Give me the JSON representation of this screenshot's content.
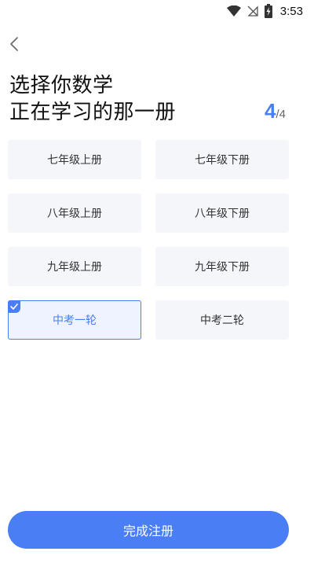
{
  "status_bar": {
    "time": "3:53",
    "icons": [
      "wifi-icon",
      "no-signal-icon",
      "battery-charging-icon"
    ]
  },
  "header": {
    "back_icon": "chevron-left-icon",
    "title_line1": "选择你数学",
    "title_line2": "正在学习的那一册",
    "step_current": "4",
    "step_total": "/4"
  },
  "options": [
    {
      "label": "七年级上册",
      "selected": false
    },
    {
      "label": "七年级下册",
      "selected": false
    },
    {
      "label": "八年级上册",
      "selected": false
    },
    {
      "label": "八年级下册",
      "selected": false
    },
    {
      "label": "九年级上册",
      "selected": false
    },
    {
      "label": "九年级下册",
      "selected": false
    },
    {
      "label": "中考一轮",
      "selected": true
    },
    {
      "label": "中考二轮",
      "selected": false
    }
  ],
  "submit": {
    "label": "完成注册"
  },
  "colors": {
    "accent": "#4a7ef5",
    "option_bg": "#f4f6f9",
    "selected_bg": "#eef3ff"
  }
}
